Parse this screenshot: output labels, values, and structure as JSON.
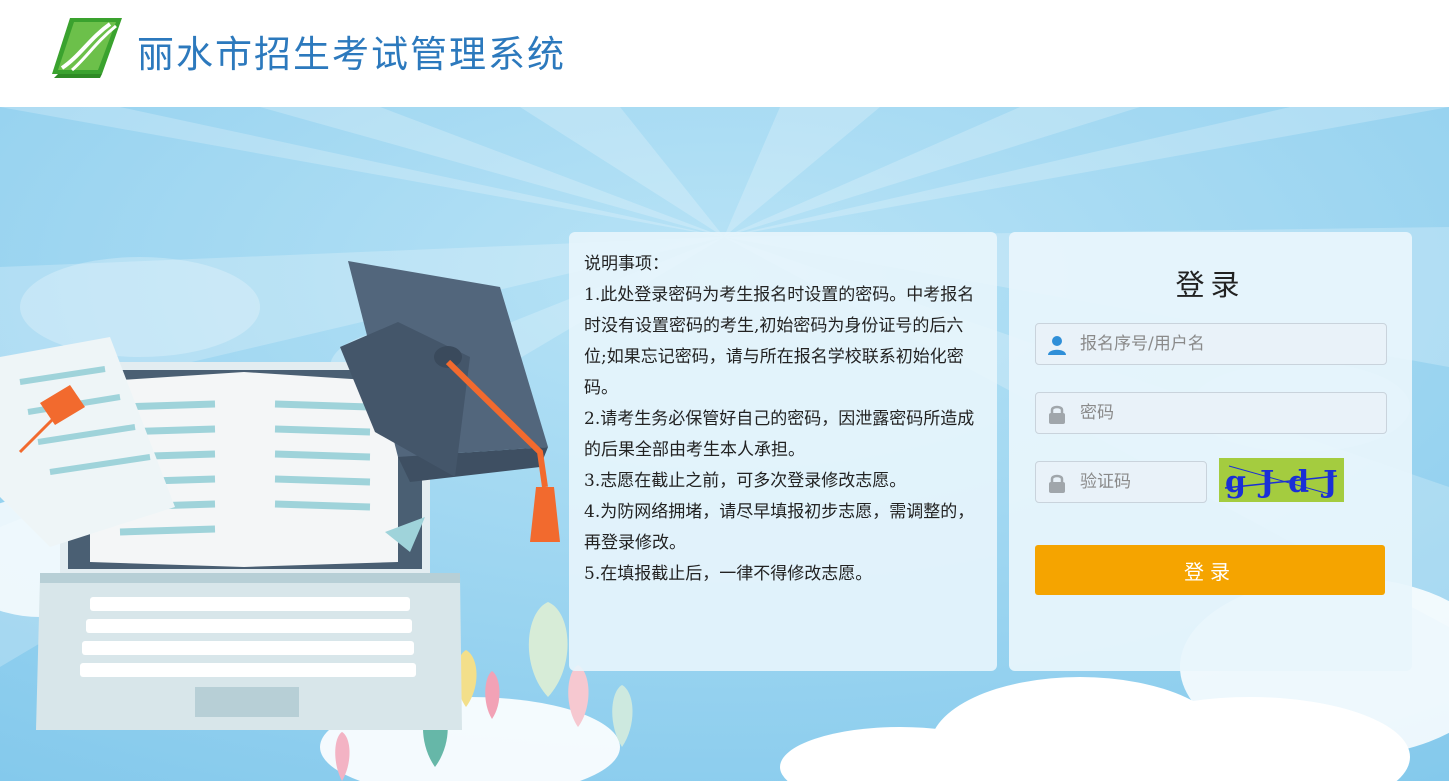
{
  "header": {
    "site_title": "丽水市招生考试管理系统"
  },
  "notice": {
    "heading": "说明事项：",
    "items": [
      "1.此处登录密码为考生报名时设置的密码。中考报名时没有设置密码的考生,初始密码为身份证号的后六位;如果忘记密码，请与所在报名学校联系初始化密码。",
      "2.请考生务必保管好自己的密码，因泄露密码所造成的后果全部由考生本人承担。",
      "3.志愿在截止之前，可多次登录修改志愿。",
      "4.为防网络拥堵，请尽早填报初步志愿，需调整的，再登录修改。",
      "5.在填报截止后，一律不得修改志愿。"
    ]
  },
  "login": {
    "title": "登录",
    "username_placeholder": "报名序号/用户名",
    "password_placeholder": "密码",
    "captcha_placeholder": "验证码",
    "captcha_text": "gJdJ",
    "submit_label": "登录"
  },
  "colors": {
    "brand_blue": "#2c79bd",
    "sky": "#8fd0ef",
    "submit_orange": "#f5a400",
    "captcha_bg": "#a4cc3f",
    "captcha_text": "#1a2fd6"
  },
  "icons": {
    "logo": "book-logo-icon",
    "username": "user-icon",
    "password": "lock-icon",
    "captcha": "lock-icon"
  }
}
